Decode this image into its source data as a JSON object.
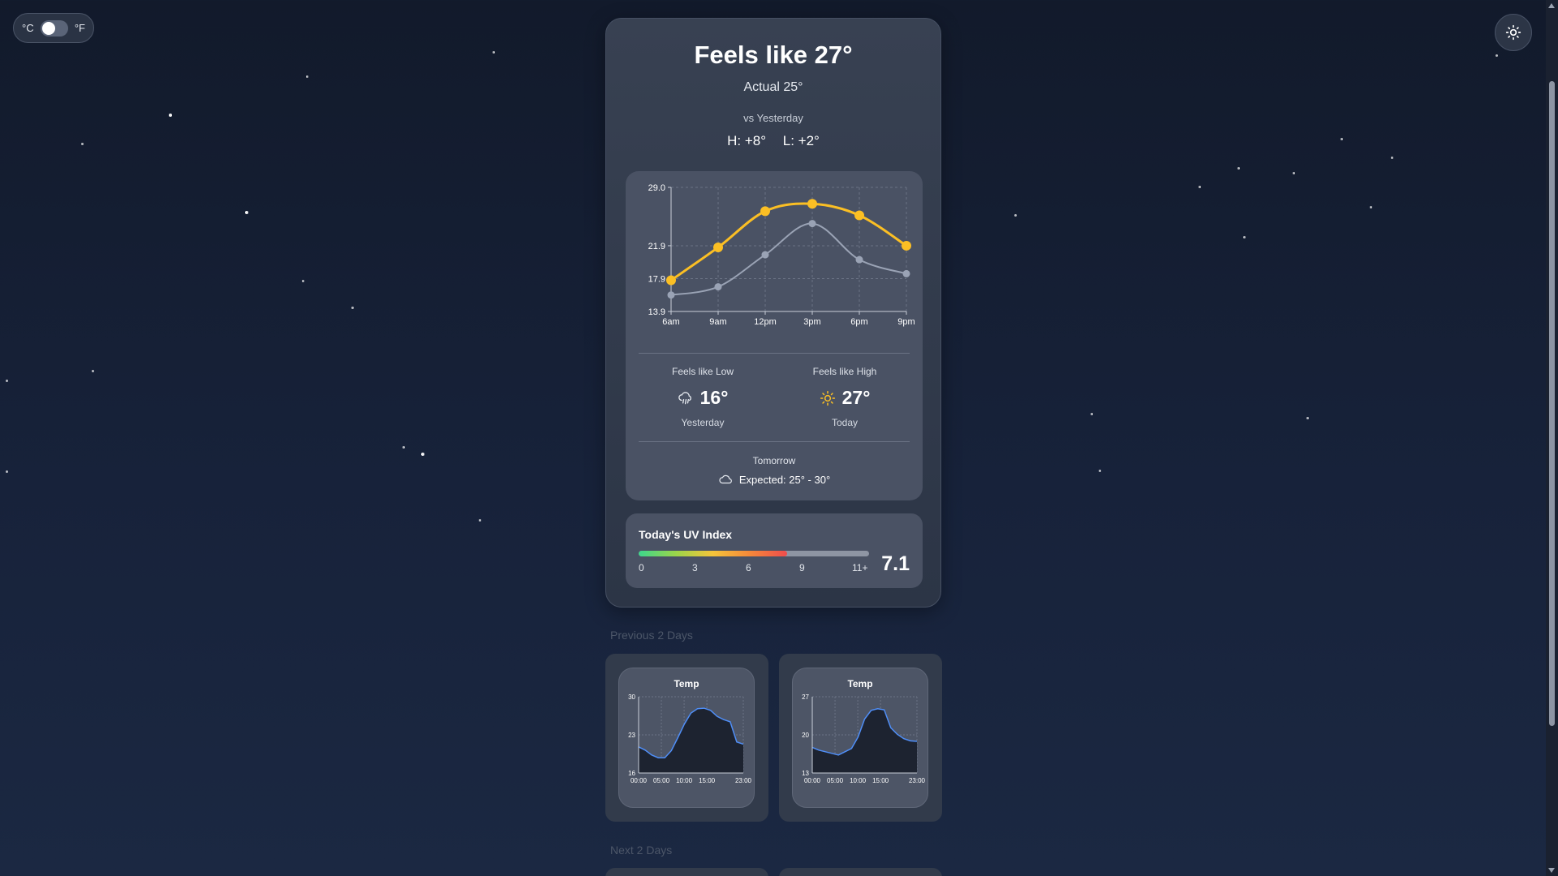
{
  "unit_toggle": {
    "celsius_label": "°C",
    "fahrenheit_label": "°F"
  },
  "theme_button": {
    "icon": "sun-icon"
  },
  "header": {
    "title": "Feels like 27°",
    "actual": "Actual 25°",
    "vs_label": "vs Yesterday",
    "high_diff": "H: +8°",
    "low_diff": "L: +2°"
  },
  "chart_data": {
    "type": "line",
    "categories": [
      "6am",
      "9am",
      "12pm",
      "3pm",
      "6pm",
      "9pm"
    ],
    "y_ticks": [
      "29.0",
      "21.9",
      "17.9",
      "13.9"
    ],
    "ylim": [
      13.9,
      29.0
    ],
    "grid": true,
    "series": [
      {
        "values": [
          17.7,
          21.7,
          26.1,
          27.0,
          25.6,
          21.9
        ],
        "color": "#fbbf24"
      },
      {
        "values": [
          15.9,
          16.9,
          20.8,
          24.6,
          20.2,
          18.5
        ],
        "color": "#9aa3b5"
      }
    ]
  },
  "feels_low": {
    "label": "Feels like Low",
    "value": "16°",
    "sub": "Yesterday",
    "icon": "rain-cloud-icon"
  },
  "feels_high": {
    "label": "Feels like High",
    "value": "27°",
    "sub": "Today",
    "icon": "sun-icon"
  },
  "tomorrow": {
    "label": "Tomorrow",
    "expected": "Expected: 25° - 30°",
    "icon": "cloud-icon"
  },
  "uv": {
    "title": "Today's UV Index",
    "value": "7.1",
    "fraction": 0.645,
    "ticks": [
      "0",
      "3",
      "6",
      "9",
      "11+"
    ]
  },
  "sections": {
    "previous": "Previous 2 Days",
    "next": "Next 2 Days"
  },
  "previous_days": [
    {
      "title": "Temp",
      "y_ticks": [
        "30",
        "23",
        "16"
      ],
      "x_ticks": [
        "00:00",
        "05:00",
        "10:00",
        "15:00",
        "23:00"
      ],
      "ylim": [
        16,
        30
      ],
      "values": [
        20.8,
        20.2,
        19.3,
        18.8,
        18.8,
        20.1,
        22.5,
        25.0,
        27.0,
        27.8,
        27.9,
        27.5,
        26.4,
        25.8,
        25.4,
        21.7,
        21.3
      ]
    },
    {
      "title": "Temp",
      "y_ticks": [
        "27",
        "20",
        "13"
      ],
      "x_ticks": [
        "00:00",
        "05:00",
        "10:00",
        "15:00",
        "23:00"
      ],
      "ylim": [
        13,
        27
      ],
      "values": [
        17.7,
        17.2,
        16.9,
        16.6,
        16.3,
        16.9,
        17.5,
        19.6,
        22.9,
        24.5,
        24.8,
        24.6,
        21.3,
        20.1,
        19.3,
        18.9,
        18.8
      ]
    }
  ],
  "colors": {
    "accent": "#fbbf24",
    "comparison": "#9aa3b5",
    "day_line": "#4f8ef7"
  }
}
